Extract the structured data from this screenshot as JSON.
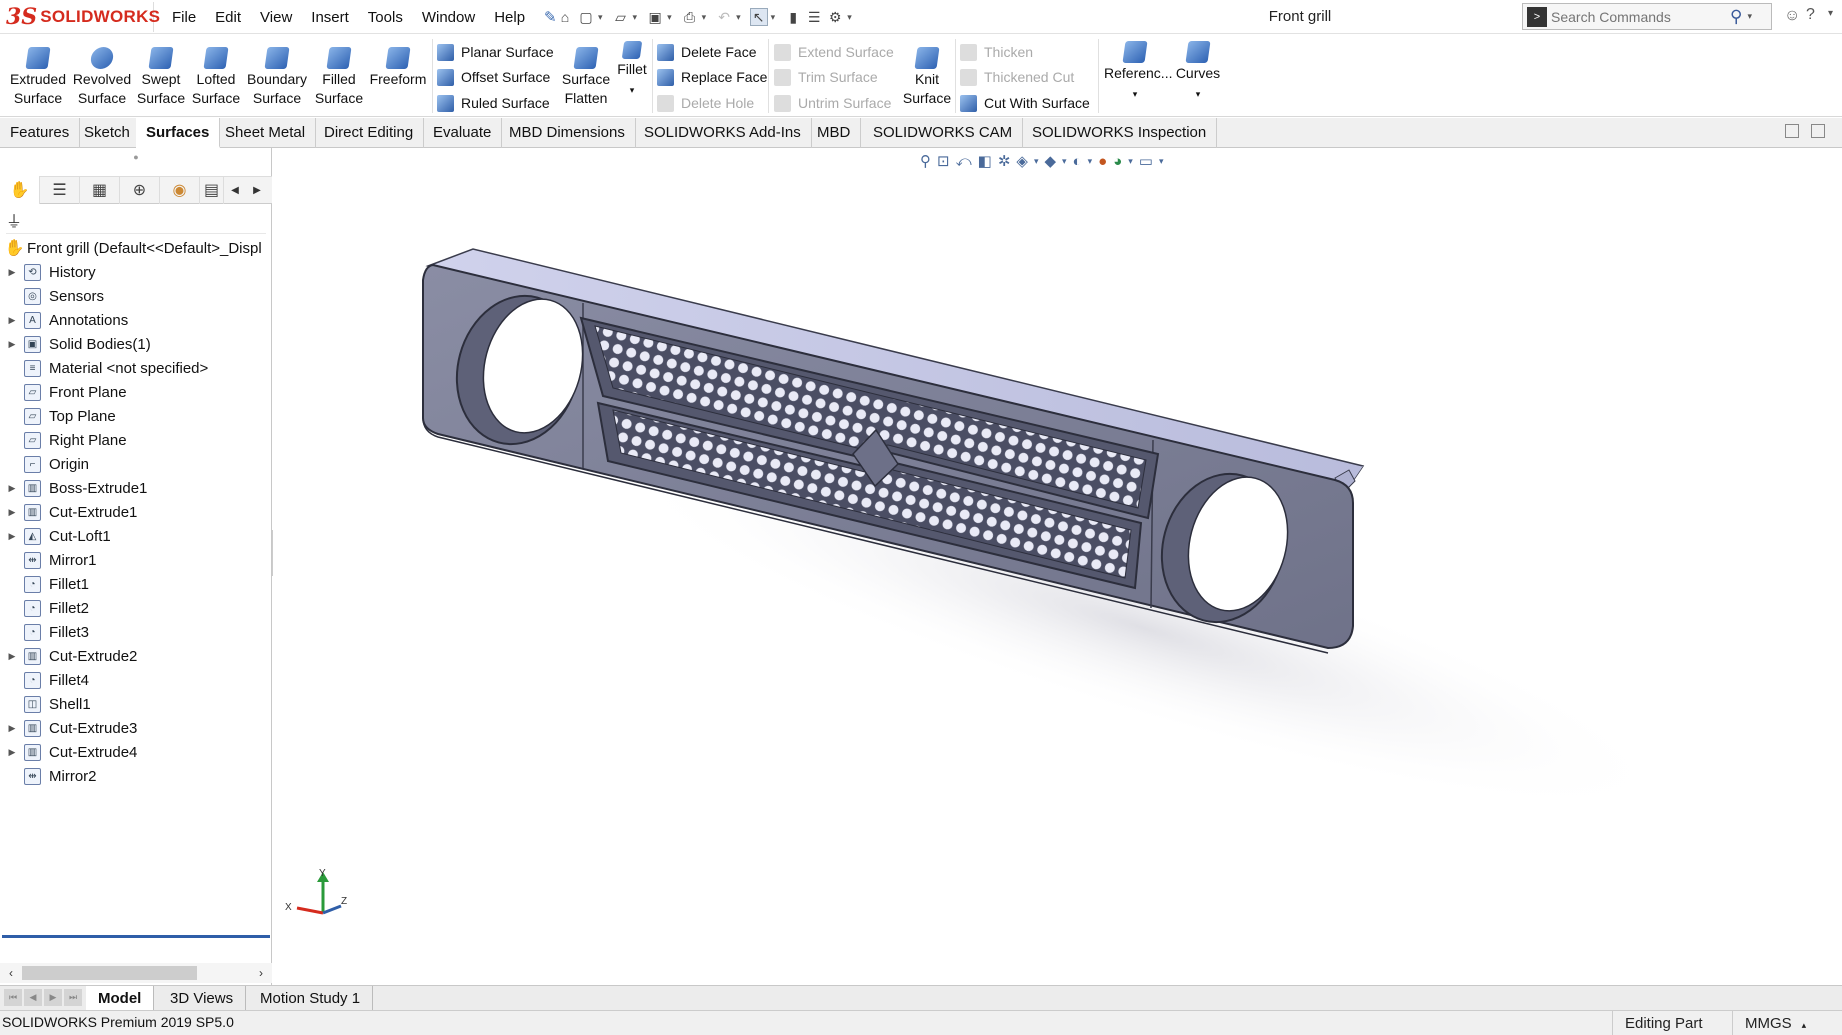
{
  "app": {
    "brand_mark": "3S",
    "brand_text": "SOLIDWORKS",
    "document_title": "Front grill"
  },
  "menu": [
    "File",
    "Edit",
    "View",
    "Insert",
    "Tools",
    "Window",
    "Help"
  ],
  "search": {
    "placeholder": "Search Commands"
  },
  "ribbon": {
    "extruded_surface": [
      "Extruded",
      "Surface"
    ],
    "revolved_surface": [
      "Revolved",
      "Surface"
    ],
    "swept_surface": [
      "Swept",
      "Surface"
    ],
    "lofted_surface": [
      "Lofted",
      "Surface"
    ],
    "boundary_surface": [
      "Boundary",
      "Surface"
    ],
    "filled_surface": [
      "Filled",
      "Surface"
    ],
    "freeform": "Freeform",
    "planar_surface": "Planar Surface",
    "offset_surface": "Offset Surface",
    "ruled_surface": "Ruled Surface",
    "surface_flatten": [
      "Surface",
      "Flatten"
    ],
    "fillet": "Fillet",
    "delete_face": "Delete Face",
    "replace_face": "Replace Face",
    "delete_hole": "Delete Hole",
    "extend_surface": "Extend Surface",
    "trim_surface": "Trim Surface",
    "untrim_surface": "Untrim Surface",
    "knit_surface": [
      "Knit",
      "Surface"
    ],
    "thicken": "Thicken",
    "thickened_cut": "Thickened Cut",
    "cut_with_surface": "Cut With Surface",
    "reference": "Referenc...",
    "curves": "Curves"
  },
  "command_tabs": [
    "Features",
    "Sketch",
    "Surfaces",
    "Sheet Metal",
    "Direct Editing",
    "Evaluate",
    "MBD Dimensions",
    "SOLIDWORKS Add-Ins",
    "MBD",
    "SOLIDWORKS CAM",
    "SOLIDWORKS Inspection"
  ],
  "active_tab": "Surfaces",
  "tree": {
    "root": "Front grill  (Default<<Default>_Displ",
    "items": [
      {
        "label": "History",
        "expandable": true
      },
      {
        "label": "Sensors",
        "expandable": false
      },
      {
        "label": "Annotations",
        "expandable": true
      },
      {
        "label": "Solid Bodies(1)",
        "expandable": true
      },
      {
        "label": "Material <not specified>",
        "expandable": false
      },
      {
        "label": "Front Plane",
        "expandable": false
      },
      {
        "label": "Top Plane",
        "expandable": false
      },
      {
        "label": "Right Plane",
        "expandable": false
      },
      {
        "label": "Origin",
        "expandable": false
      },
      {
        "label": "Boss-Extrude1",
        "expandable": true
      },
      {
        "label": "Cut-Extrude1",
        "expandable": true
      },
      {
        "label": "Cut-Loft1",
        "expandable": true
      },
      {
        "label": "Mirror1",
        "expandable": false
      },
      {
        "label": "Fillet1",
        "expandable": false
      },
      {
        "label": "Fillet2",
        "expandable": false
      },
      {
        "label": "Fillet3",
        "expandable": false
      },
      {
        "label": "Cut-Extrude2",
        "expandable": true
      },
      {
        "label": "Fillet4",
        "expandable": false
      },
      {
        "label": "Shell1",
        "expandable": false
      },
      {
        "label": "Cut-Extrude3",
        "expandable": true
      },
      {
        "label": "Cut-Extrude4",
        "expandable": true
      },
      {
        "label": "Mirror2",
        "expandable": false
      }
    ]
  },
  "bottom_tabs": [
    "Model",
    "3D Views",
    "Motion Study 1"
  ],
  "active_bottom_tab": "Model",
  "status": {
    "version": "SOLIDWORKS Premium 2019 SP5.0",
    "mode": "Editing Part",
    "units": "MMGS"
  },
  "triad": {
    "x": "X",
    "y": "Y",
    "z": "Z"
  },
  "colors": {
    "brand": "#d52b1e",
    "model_face": "#7d8097",
    "model_top": "#c7c9e6",
    "selection": "#2f5ea8"
  }
}
